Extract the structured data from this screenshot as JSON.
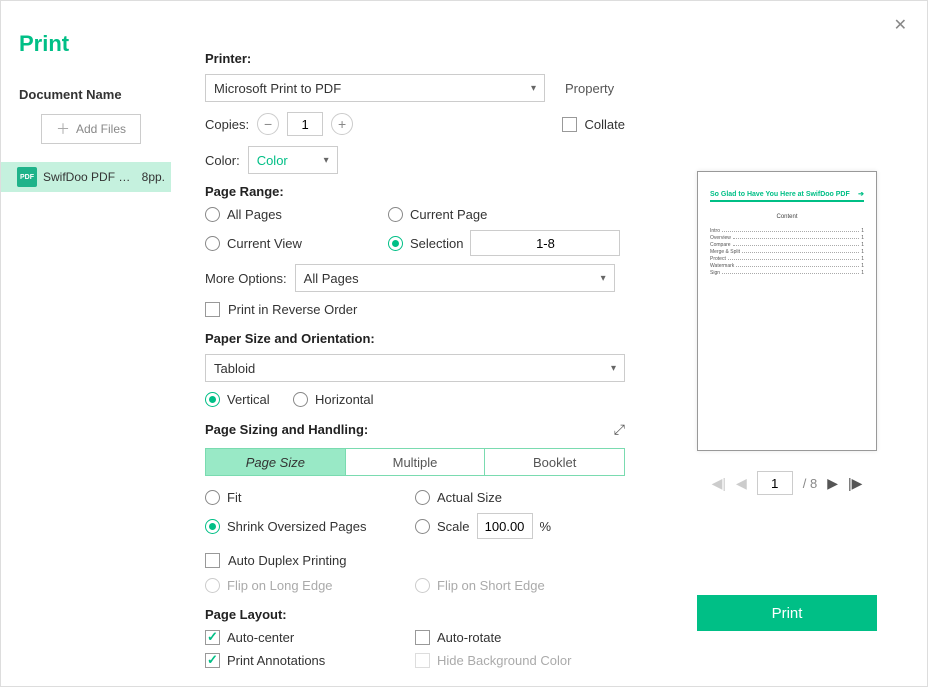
{
  "title": "Print",
  "sidebar": {
    "heading": "Document Name",
    "add_files": "Add Files",
    "file": {
      "badge": "PDF",
      "name": "SwifDoo PDF Us..",
      "pages": "8pp."
    }
  },
  "printer": {
    "label": "Printer:",
    "selected": "Microsoft Print to PDF",
    "property": "Property"
  },
  "copies": {
    "label": "Copies:",
    "value": "1",
    "collate": "Collate"
  },
  "color": {
    "label": "Color:",
    "selected": "Color"
  },
  "page_range": {
    "label": "Page Range:",
    "all": "All Pages",
    "current_page": "Current Page",
    "current_view": "Current View",
    "selection": "Selection",
    "selection_value": "1-8"
  },
  "more_options": {
    "label": "More Options:",
    "selected": "All Pages"
  },
  "reverse": "Print in Reverse Order",
  "paper": {
    "label": "Paper Size and Orientation:",
    "selected": "Tabloid",
    "vertical": "Vertical",
    "horizontal": "Horizontal"
  },
  "sizing": {
    "label": "Page Sizing and Handling:",
    "tabs": {
      "page_size": "Page Size",
      "multiple": "Multiple",
      "booklet": "Booklet"
    },
    "fit": "Fit",
    "actual": "Actual Size",
    "shrink": "Shrink Oversized Pages",
    "scale": "Scale",
    "scale_value": "100.00",
    "scale_unit": "%"
  },
  "duplex": {
    "auto": "Auto Duplex Printing",
    "long": "Flip on Long Edge",
    "short": "Flip on Short Edge"
  },
  "layout": {
    "label": "Page Layout:",
    "auto_center": "Auto-center",
    "auto_rotate": "Auto-rotate",
    "annotations": "Print Annotations",
    "hide_bg": "Hide Background Color"
  },
  "preview": {
    "heading": "So Glad to Have You Here at SwifDoo PDF",
    "content": "Content",
    "toc": [
      "Intro",
      "Overview",
      "Compare",
      "Merge & Split",
      "Protect",
      "Watermark",
      "Sign"
    ],
    "page": "1",
    "total": "/ 8"
  },
  "print_button": "Print"
}
